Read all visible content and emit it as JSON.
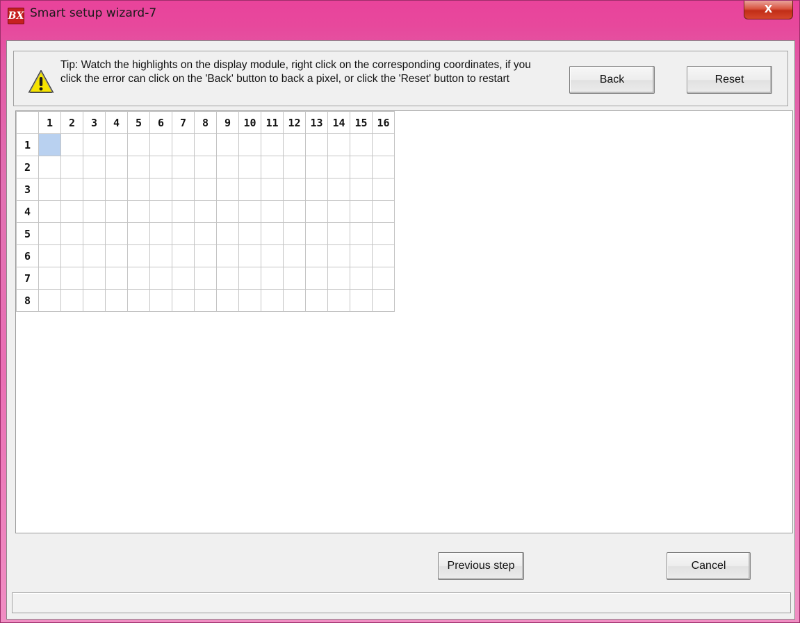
{
  "window": {
    "title": "Smart setup wizard-7",
    "app_icon_text": "BX",
    "close_symbol": "X"
  },
  "tip": {
    "text": "Tip: Watch the highlights on the display module, right click on the corresponding coordinates, if you click the error can click on the 'Back' button to back a pixel, or click the 'Reset' button to restart",
    "icon": "warning-icon"
  },
  "buttons": {
    "back": "Back",
    "reset": "Reset",
    "previous": "Previous step",
    "cancel": "Cancel"
  },
  "grid": {
    "columns": [
      "1",
      "2",
      "3",
      "4",
      "5",
      "6",
      "7",
      "8",
      "9",
      "10",
      "11",
      "12",
      "13",
      "14",
      "15",
      "16"
    ],
    "rows": [
      "1",
      "2",
      "3",
      "4",
      "5",
      "6",
      "7",
      "8"
    ],
    "highlighted_cell": {
      "row": "1",
      "column": "1"
    },
    "highlight_color": "#b9d1f0"
  },
  "status": {
    "text": ""
  }
}
